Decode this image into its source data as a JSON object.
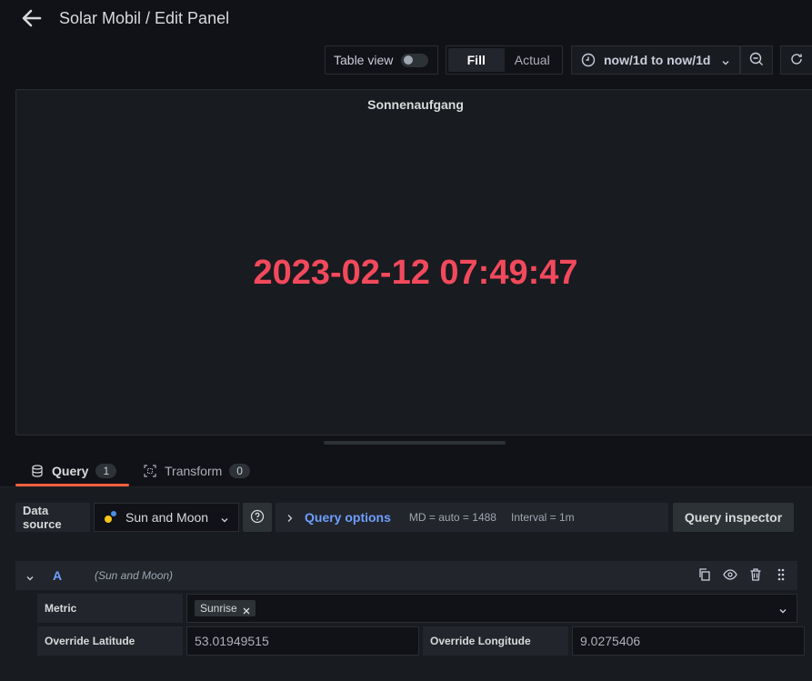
{
  "header": {
    "title": "Solar Mobil / Edit Panel",
    "back_icon": "arrow-left-icon"
  },
  "toolbar": {
    "table_view_label": "Table view",
    "table_view_on": false,
    "fill_label": "Fill",
    "actual_label": "Actual",
    "time_range": "now/1d to now/1d"
  },
  "panel": {
    "title": "Sonnenaufgang",
    "value": "2023-02-12 07:49:47",
    "value_color": "#f2495c"
  },
  "tabs": [
    {
      "label": "Query",
      "count": "1",
      "active": true
    },
    {
      "label": "Transform",
      "count": "0",
      "active": false
    }
  ],
  "datasource": {
    "label": "Data source",
    "name": "Sun and Moon",
    "query_options_label": "Query options",
    "md": "MD = auto = 1488",
    "interval": "Interval = 1m",
    "inspector_label": "Query inspector"
  },
  "query": {
    "ref_id": "A",
    "ds_name": "(Sun and Moon)",
    "metric_label": "Metric",
    "metric_value": "Sunrise",
    "lat_label": "Override Latitude",
    "lat_value": "53.01949515",
    "lon_label": "Override Longitude",
    "lon_value": "9.0275406"
  },
  "colors": {
    "accent": "#6e9fff",
    "tab_underline": "#f55f3e",
    "background": "#111217"
  }
}
